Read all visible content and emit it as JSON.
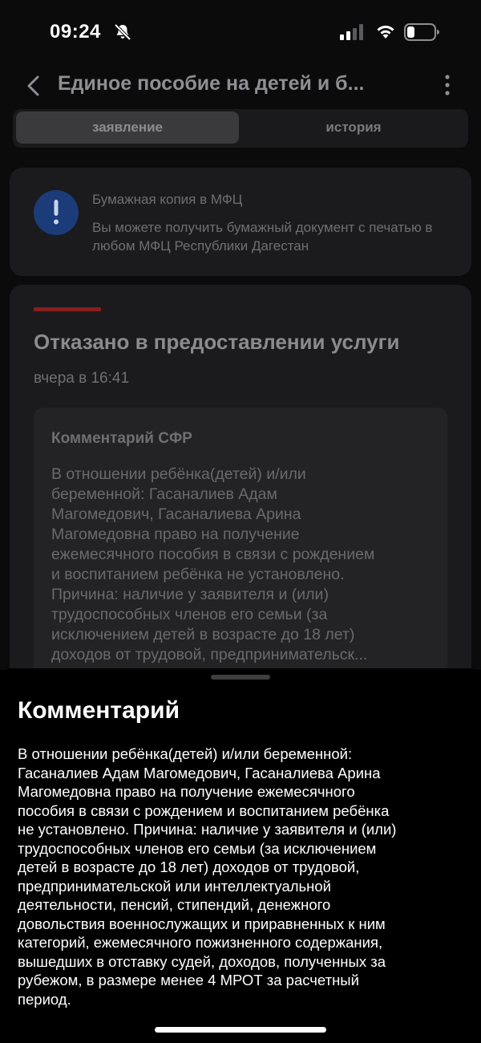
{
  "status_bar": {
    "time": "09:24",
    "icons": [
      "bell-slash-icon",
      "cellular-signal-icon",
      "wifi-icon",
      "battery-icon"
    ]
  },
  "header": {
    "back_icon": "chevron-left-icon",
    "title": "Единое пособие на детей и б...",
    "more_icon": "more-vertical-icon"
  },
  "tabs": [
    {
      "label": "заявление",
      "active": true
    },
    {
      "label": "история",
      "active": false
    }
  ],
  "info_card": {
    "icon": "exclamation-icon",
    "icon_color": "#1b3c79",
    "title": "Бумажная копия в МФЦ",
    "text": "Вы можете получить бумажный документ с печатью в любом МФЦ Республики Дагестан"
  },
  "status_card": {
    "status_color": "#8a1d1d",
    "title": "Отказано в предоставлении услуги",
    "time": "вчера в 16:41",
    "comment_title": "Комментарий СФР",
    "comment_lines": [
      "В отношении ребёнка(детей) и/или",
      "беременной: Гасаналиев Адам",
      "Магомедович, Гасаналиева Арина",
      "Магомедовна право на получение",
      "ежемесячного пособия в связи с рождением",
      "и воспитанием ребёнка не установлено.",
      "Причина: наличие у заявителя и (или)",
      "трудоспособных членов его семьи (за",
      "исключением детей в возрасте до 18 лет)",
      "доходов от трудовой, предпринимательск..."
    ]
  },
  "sheet": {
    "title": "Комментарий",
    "lines": [
      "В отношении ребёнка(детей) и/или беременной:",
      "Гасаналиев Адам Магомедович, Гасаналиева Арина",
      "Магомедовна право на получение ежемесячного",
      "пособия в связи с рождением и воспитанием ребёнка",
      "не установлено. Причина: наличие у заявителя и (или)",
      "трудоспособных членов его семьи (за исключением",
      "детей в возрасте до 18 лет) доходов от трудовой,",
      "предпринимательской или интеллектуальной",
      "деятельности, пенсий, стипендий, денежного",
      "довольствия военнослужащих и приравненных к ним",
      "категорий, ежемесячного пожизненного содержания,",
      "вышедших в отставку судей, доходов, полученных за",
      "рубежом, в размере менее 4 МРОТ за расчетный",
      "период."
    ]
  }
}
